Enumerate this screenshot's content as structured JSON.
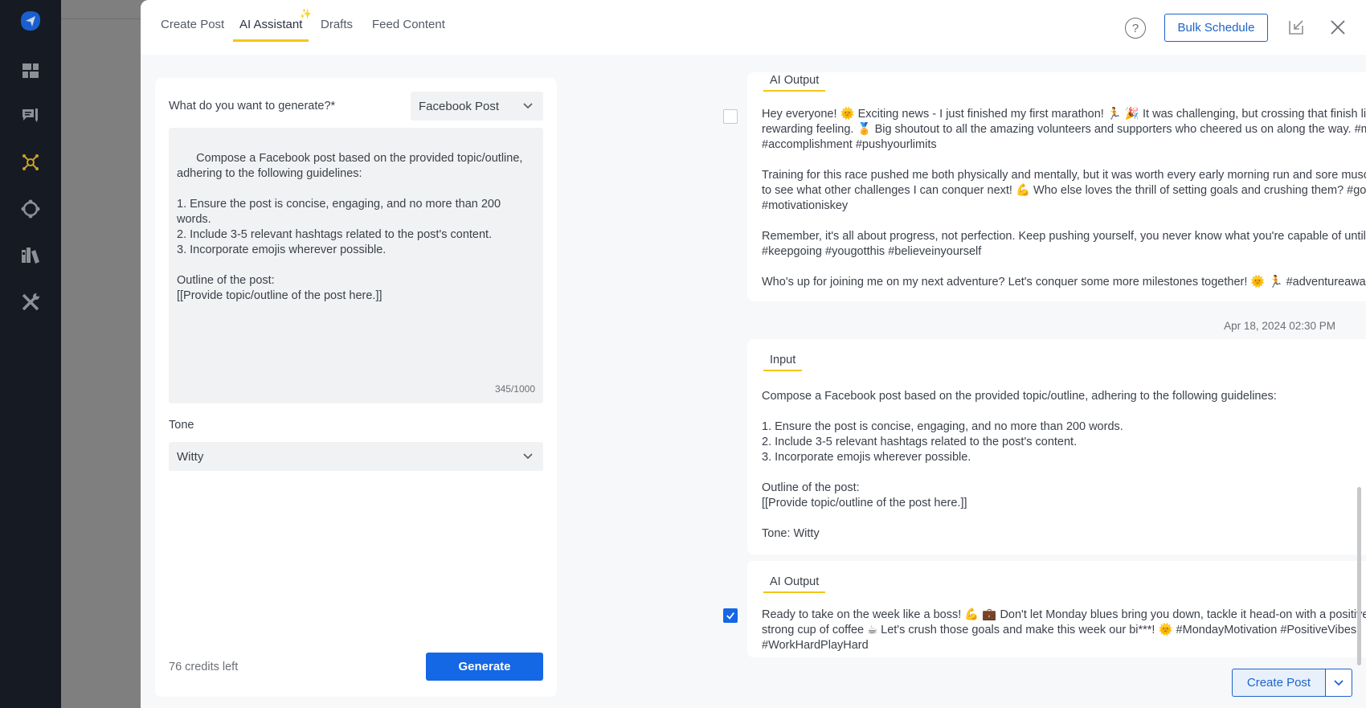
{
  "sidebar": {
    "items": [
      {
        "icon": "send-logo-icon",
        "active": false
      },
      {
        "icon": "dashboard-icon",
        "active": false
      },
      {
        "icon": "compose-icon",
        "active": false
      },
      {
        "icon": "network-hub-icon",
        "active": true
      },
      {
        "icon": "engage-circle-icon",
        "active": false
      },
      {
        "icon": "library-icon",
        "active": false
      },
      {
        "icon": "tools-icon",
        "active": false
      }
    ]
  },
  "header": {
    "tabs": [
      {
        "label": "Create Post"
      },
      {
        "label": "AI Assistant",
        "active": true
      },
      {
        "label": "Drafts"
      },
      {
        "label": "Feed Content"
      }
    ],
    "sparkle": "✨",
    "help": "?",
    "bulk_schedule": "Bulk Schedule"
  },
  "form": {
    "generate_label": "What do you want to generate?*",
    "generate_value": "Facebook Post",
    "prompt": "Compose a Facebook post based on the provided topic/outline,\nadhering to the following guidelines:\n\n1. Ensure the post is concise, engaging, and no more than 200 words.\n2. Include 3-5 relevant hashtags related to the post's content.\n3. Incorporate emojis wherever possible.\n\nOutline of the post:\n[[Provide topic/outline of the post here.]]",
    "counter": "345/1000",
    "tone_label": "Tone",
    "tone_value": "Witty",
    "credits": "76 credits left",
    "generate_button": "Generate"
  },
  "history": {
    "card1": {
      "label": "AI Output",
      "checked": false,
      "text": "Hey everyone! 🌞 Exciting news - I just finished my first marathon! 🏃 🎉 It was challenging, but crossing that finish line was such a rewarding feeling. 🏅 Big shoutout to all the amazing volunteers and supporters who cheered us on along the way. #marathonrunner #accomplishment #pushyourlimits\n\nTraining for this race pushed me both physically and mentally, but it was worth every early morning run and sore muscle. 🌅 Can't wait to see what other challenges I can conquer next! 💪 Who else loves the thrill of setting goals and crushing them? #goalgetter #motivationiskey\n\nRemember, it's all about progress, not perfection. Keep pushing yourself, you never know what you're capable of until you try! ✨ #keepgoing #yougotthis #believeinyourself\n\nWho's up for joining me on my next adventure? Let's conquer some more milestones together! 🌞 🏃 #adventureawaits #runwithme"
    },
    "timestamp": "Apr 18, 2024 02:30 PM",
    "card2": {
      "label": "Input",
      "text": "Compose a Facebook post based on the provided topic/outline, adhering to the following guidelines:\n\n1. Ensure the post is concise, engaging, and no more than 200 words.\n2. Include 3-5 relevant hashtags related to the post's content.\n3. Incorporate emojis wherever possible.\n\nOutline of the post:\n[[Provide topic/outline of the post here.]]\n\nTone: Witty"
    },
    "card3": {
      "label": "AI Output",
      "checked": true,
      "text": "Ready to take on the week like a boss! 💪 💼 Don't let Monday blues bring you down, tackle it head-on with a positive mindset and a strong cup of coffee ☕ Let's crush those goals and make this week our bi***! 🌞 #MondayMotivation #PositiveVibes #WorkHardPlayHard"
    }
  },
  "footer": {
    "create_post": "Create Post"
  },
  "colors": {
    "accent": "#1467e5",
    "tab_underline": "#f5c518",
    "sidebar_bg": "#161a22",
    "active_sidebar_icon": "#c9a227"
  }
}
